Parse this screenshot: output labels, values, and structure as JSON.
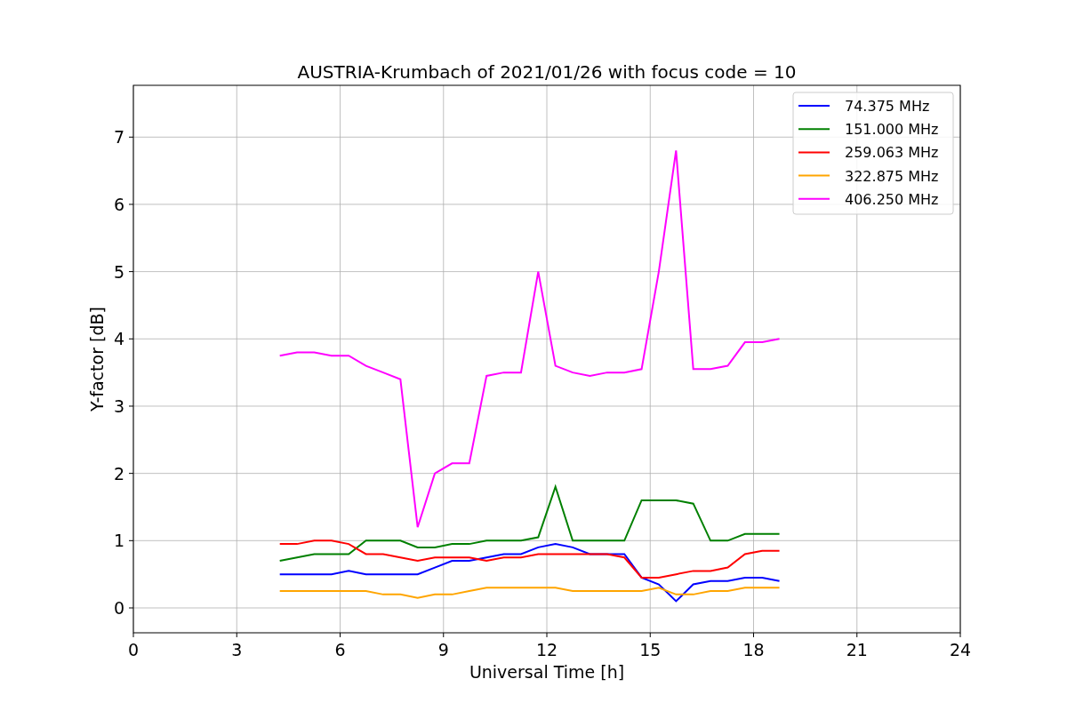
{
  "chart_data": {
    "type": "line",
    "title": "AUSTRIA-Krumbach of 2021/01/26 with focus code = 10",
    "xlabel": "Universal Time [h]",
    "ylabel": "Y-factor [dB]",
    "x": [
      4.25,
      4.75,
      5.25,
      5.75,
      6.25,
      6.75,
      7.25,
      7.75,
      8.25,
      8.75,
      9.25,
      9.75,
      10.25,
      10.75,
      11.25,
      11.75,
      12.25,
      12.75,
      13.25,
      13.75,
      14.25,
      14.75,
      15.25,
      15.75,
      16.25,
      16.75,
      17.25,
      17.75,
      18.25,
      18.75
    ],
    "xlim": [
      0,
      24
    ],
    "ylim": [
      -0.37,
      7.77
    ],
    "grid": true,
    "legend": true,
    "xticks": [
      0,
      3,
      6,
      9,
      12,
      15,
      18,
      21,
      24
    ],
    "yticks": [
      0,
      1,
      2,
      3,
      4,
      5,
      6,
      7
    ],
    "series": [
      {
        "name": "74.375 MHz",
        "color": "#0000ff",
        "values": [
          0.5,
          0.5,
          0.5,
          0.5,
          0.55,
          0.5,
          0.5,
          0.5,
          0.5,
          0.6,
          0.7,
          0.7,
          0.75,
          0.8,
          0.8,
          0.9,
          0.95,
          0.9,
          0.8,
          0.8,
          0.8,
          0.45,
          0.35,
          0.1,
          0.35,
          0.4,
          0.4,
          0.45,
          0.45,
          0.4
        ]
      },
      {
        "name": "151.000 MHz",
        "color": "#008000",
        "values": [
          0.7,
          0.75,
          0.8,
          0.8,
          0.8,
          1.0,
          1.0,
          1.0,
          0.9,
          0.9,
          0.95,
          0.95,
          1.0,
          1.0,
          1.0,
          1.05,
          1.8,
          1.0,
          1.0,
          1.0,
          1.0,
          1.6,
          1.6,
          1.6,
          1.55,
          1.0,
          1.0,
          1.1,
          1.1,
          1.1
        ]
      },
      {
        "name": "259.063 MHz",
        "color": "#ff0000",
        "values": [
          0.95,
          0.95,
          1.0,
          1.0,
          0.95,
          0.8,
          0.8,
          0.75,
          0.7,
          0.75,
          0.75,
          0.75,
          0.7,
          0.75,
          0.75,
          0.8,
          0.8,
          0.8,
          0.8,
          0.8,
          0.75,
          0.45,
          0.45,
          0.5,
          0.55,
          0.55,
          0.6,
          0.8,
          0.85,
          0.85
        ]
      },
      {
        "name": "322.875 MHz",
        "color": "#ffa500",
        "values": [
          0.25,
          0.25,
          0.25,
          0.25,
          0.25,
          0.25,
          0.2,
          0.2,
          0.15,
          0.2,
          0.2,
          0.25,
          0.3,
          0.3,
          0.3,
          0.3,
          0.3,
          0.25,
          0.25,
          0.25,
          0.25,
          0.25,
          0.3,
          0.2,
          0.2,
          0.25,
          0.25,
          0.3,
          0.3,
          0.3
        ]
      },
      {
        "name": "406.250 MHz",
        "color": "#ff00ff",
        "values": [
          3.75,
          3.8,
          3.8,
          3.75,
          3.75,
          3.6,
          3.5,
          3.4,
          1.2,
          2.0,
          2.15,
          2.15,
          3.45,
          3.5,
          3.5,
          5.0,
          3.6,
          3.5,
          3.45,
          3.5,
          3.5,
          3.55,
          5.0,
          6.8,
          3.55,
          3.55,
          3.6,
          3.95,
          3.95,
          4.0
        ]
      }
    ]
  }
}
